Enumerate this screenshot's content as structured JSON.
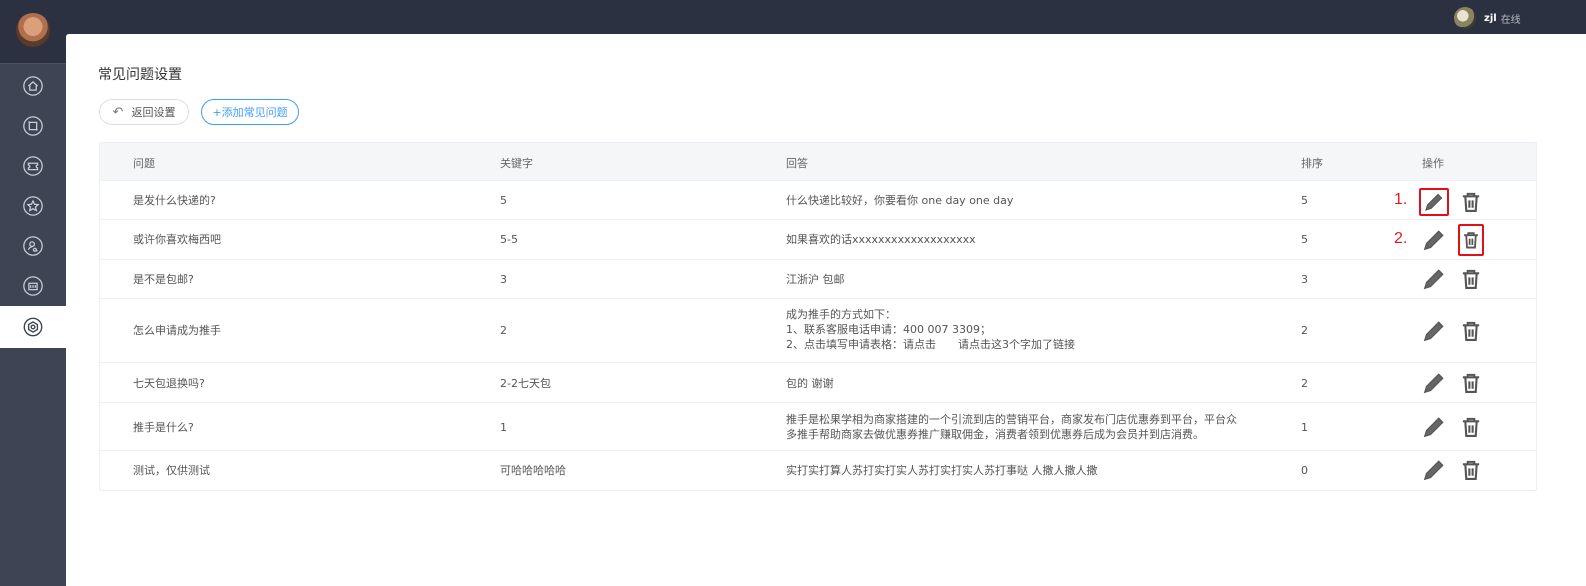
{
  "user": {
    "name": "zjl",
    "status": "在线"
  },
  "page": {
    "title": "常见问题设置"
  },
  "toolbar": {
    "back_label": "返回设置",
    "add_label": "+添加常见问题"
  },
  "table": {
    "headers": {
      "question": "问题",
      "keyword": "关键字",
      "answer": "回答",
      "sort": "排序",
      "action": "操作"
    },
    "rows": [
      {
        "question": "是发什么快递的?",
        "keyword": "5",
        "answer": [
          "什么快递比较好，你要看你 one day one day"
        ],
        "sort": "5"
      },
      {
        "question": "或许你喜欢梅西吧",
        "keyword": "5-5",
        "answer": [
          "如果喜欢的话xxxxxxxxxxxxxxxxxxx"
        ],
        "sort": "5"
      },
      {
        "question": "是不是包邮?",
        "keyword": "3",
        "answer": [
          "江浙沪 包邮"
        ],
        "sort": "3"
      },
      {
        "question": "怎么申请成为推手",
        "keyword": "2",
        "answer": [
          "成为推手的方式如下：",
          "1、联系客服电话申请：400 007 3309；",
          "2、点击填写申请表格：请点击　　请点击这3个字加了链接"
        ],
        "sort": "2"
      },
      {
        "question": "七天包退换吗?",
        "keyword": "2-2七天包",
        "answer": [
          "包的 谢谢"
        ],
        "sort": "2"
      },
      {
        "question": "推手是什么?",
        "keyword": "1",
        "answer": [
          "推手是松果学相为商家搭建的一个引流到店的营销平台，商家发布门店优惠券到平台，平台众",
          "多推手帮助商家去做优惠券推广赚取佣金，消费者领到优惠券后成为会员并到店消费。"
        ],
        "sort": "1"
      },
      {
        "question": "测试，仅供测试",
        "keyword": "可哈哈哈哈哈",
        "answer": [
          "实打实打算人苏打实打实人苏打实打实人苏打事哒 人撒人撒人撒"
        ],
        "sort": "0"
      }
    ]
  },
  "annotations": {
    "marker1": "1.",
    "marker2": "2."
  },
  "colors": {
    "accent": "#409eff",
    "annotation": "#e01b1b",
    "sidebar": "#3d4555",
    "topbar": "#2b3141"
  },
  "icons": [
    "home-icon",
    "crop-icon",
    "coupon-icon",
    "star-icon",
    "user-search-icon",
    "store-icon",
    "settings-icon",
    "edit-icon",
    "trash-icon",
    "undo-icon"
  ]
}
